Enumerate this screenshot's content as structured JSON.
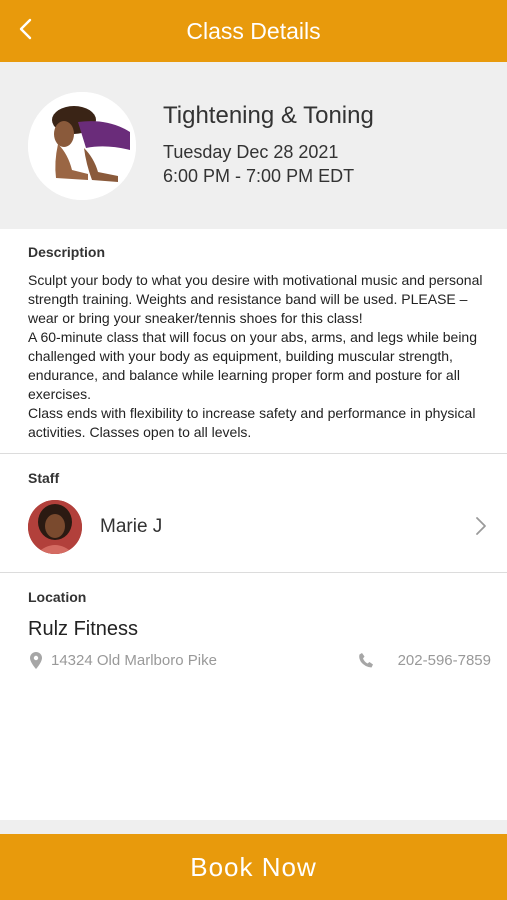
{
  "header": {
    "title": "Class Details",
    "back_icon": "chevron-left-icon"
  },
  "class": {
    "name": "Tightening & Toning",
    "date": "Tuesday Dec 28 2021",
    "time": "6:00 PM - 7:00 PM EDT"
  },
  "description": {
    "label": "Description",
    "text": "Sculpt your body to what you desire with motivational music and personal strength training. Weights and resistance band will be used. PLEASE – wear or bring your sneaker/tennis shoes for this class!\nA 60-minute class that will focus on your abs, arms, and legs while being challenged with your body as equipment, building muscular strength, endurance, and balance while learning proper form and posture for all exercises.\nClass ends with flexibility to increase safety and performance in physical activities.  Classes open to all levels."
  },
  "staff": {
    "label": "Staff",
    "name": "Marie J"
  },
  "location": {
    "label": "Location",
    "name": "Rulz Fitness",
    "address": "14324 Old Marlboro Pike",
    "phone": "202-596-7859"
  },
  "book_button": "Book Now",
  "colors": {
    "accent": "#e89a0c",
    "hero_bg": "#efefef"
  }
}
